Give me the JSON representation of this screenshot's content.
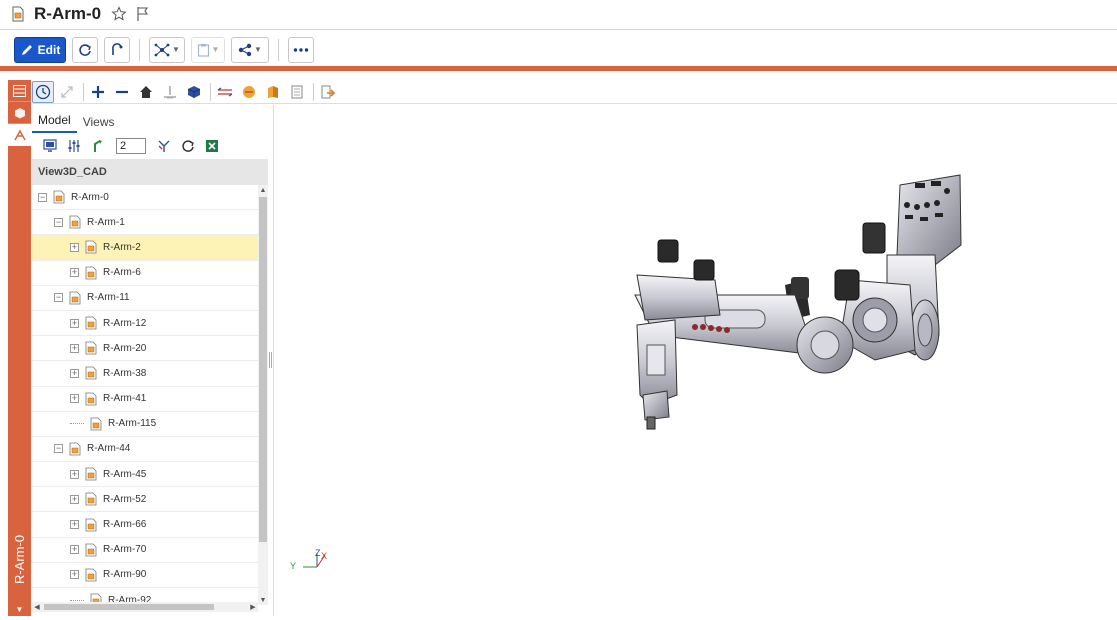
{
  "header": {
    "title": "R-Arm-0"
  },
  "toolbar": {
    "edit_label": "Edit"
  },
  "sidebar": {
    "vertical_label": "R-Arm-0"
  },
  "panel": {
    "tabs": [
      "Model",
      "Views"
    ],
    "level_value": "2",
    "tree_header": "View3D_CAD"
  },
  "tree": [
    {
      "label": "R-Arm-0",
      "depth": 0,
      "expander": "minus"
    },
    {
      "label": "R-Arm-1",
      "depth": 1,
      "expander": "minus"
    },
    {
      "label": "R-Arm-2",
      "depth": 2,
      "expander": "plus",
      "selected": true
    },
    {
      "label": "R-Arm-6",
      "depth": 2,
      "expander": "plus"
    },
    {
      "label": "R-Arm-11",
      "depth": 1,
      "expander": "minus"
    },
    {
      "label": "R-Arm-12",
      "depth": 2,
      "expander": "plus"
    },
    {
      "label": "R-Arm-20",
      "depth": 2,
      "expander": "plus"
    },
    {
      "label": "R-Arm-38",
      "depth": 2,
      "expander": "plus"
    },
    {
      "label": "R-Arm-41",
      "depth": 2,
      "expander": "plus"
    },
    {
      "label": "R-Arm-115",
      "depth": 2,
      "expander": "none"
    },
    {
      "label": "R-Arm-44",
      "depth": 1,
      "expander": "minus"
    },
    {
      "label": "R-Arm-45",
      "depth": 2,
      "expander": "plus"
    },
    {
      "label": "R-Arm-52",
      "depth": 2,
      "expander": "plus"
    },
    {
      "label": "R-Arm-66",
      "depth": 2,
      "expander": "plus"
    },
    {
      "label": "R-Arm-70",
      "depth": 2,
      "expander": "plus"
    },
    {
      "label": "R-Arm-90",
      "depth": 2,
      "expander": "plus"
    },
    {
      "label": "R-Arm-92",
      "depth": 2,
      "expander": "none"
    }
  ],
  "axes": {
    "x": "X",
    "y": "Y",
    "z": "Z"
  },
  "colors": {
    "accent": "#d9623f",
    "edit_button": "#1a57c9",
    "selected_row": "#fdf3b6"
  }
}
